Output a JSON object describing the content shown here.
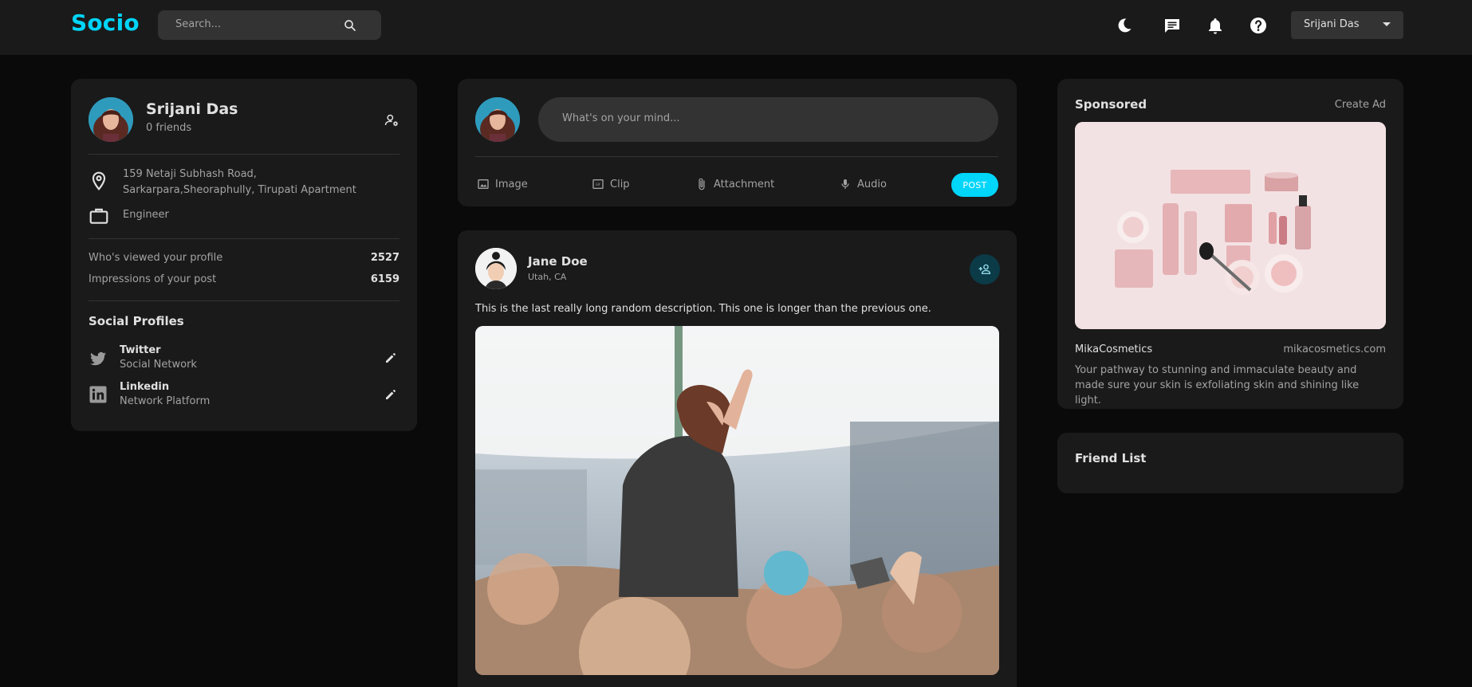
{
  "navbar": {
    "logo": "Socio",
    "search_placeholder": "Search...",
    "icons": [
      "moon-icon",
      "message-icon",
      "bell-icon",
      "help-icon"
    ],
    "user_select": "Srijani Das"
  },
  "profile": {
    "name": "Srijani Das",
    "friends": "0 friends",
    "address": "159 Netaji Subhash Road, Sarkarpara,Sheoraphully, Tirupati Apartment",
    "occupation": "Engineer",
    "stats": [
      {
        "label": "Who's viewed your profile",
        "value": "2527"
      },
      {
        "label": "Impressions of your post",
        "value": "6159"
      }
    ],
    "social_title": "Social Profiles",
    "socials": [
      {
        "name": "Twitter",
        "sub": "Social Network",
        "icon": "twitter-icon"
      },
      {
        "name": "Linkedin",
        "sub": "Network Platform",
        "icon": "linkedin-icon"
      }
    ]
  },
  "composer": {
    "placeholder": "What's on your mind...",
    "tools": [
      "Image",
      "Clip",
      "Attachment",
      "Audio"
    ],
    "post_button": "POST"
  },
  "post": {
    "author": "Jane Doe",
    "location": "Utah, CA",
    "description": "This is the last really long random description. This one is longer than the previous one."
  },
  "sponsored": {
    "title": "Sponsored",
    "create": "Create Ad",
    "brand": "MikaCosmetics",
    "site": "mikacosmetics.com",
    "description": "Your pathway to stunning and immaculate beauty and made sure your skin is exfoliating skin and shining like light."
  },
  "friend_list": {
    "title": "Friend List"
  },
  "colors": {
    "accent": "#00d5fa",
    "background": "#0a0a0a",
    "card": "#1a1a1a",
    "input": "#333333"
  }
}
